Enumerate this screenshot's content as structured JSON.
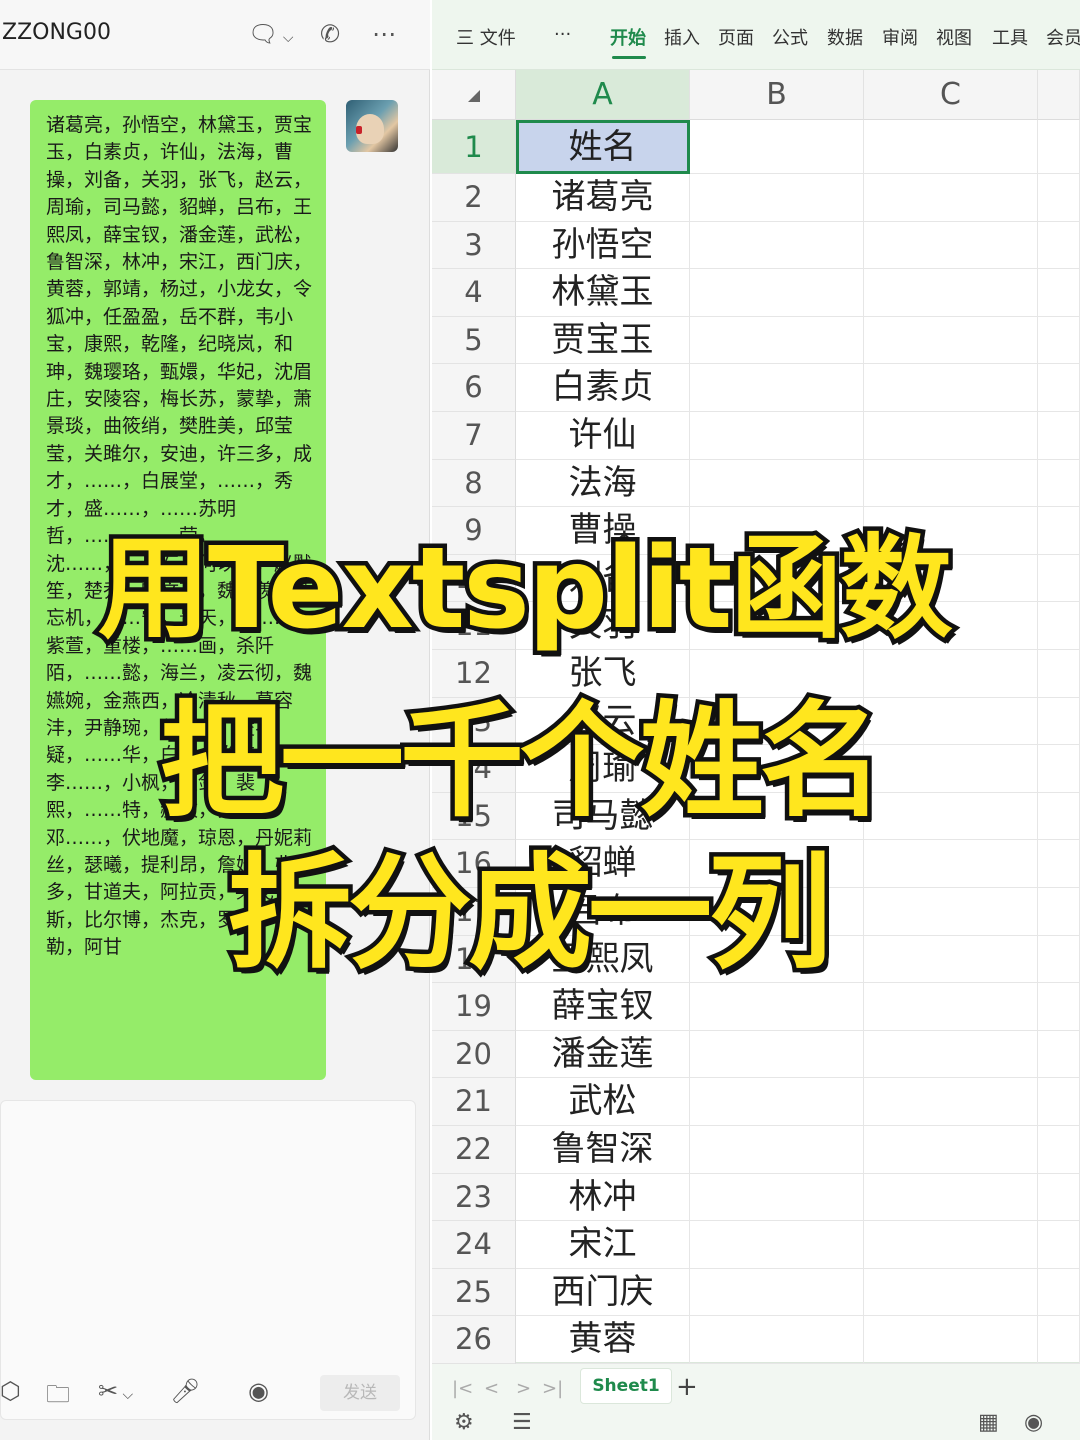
{
  "chat": {
    "title": "ZZONG00",
    "header_icons": [
      "chat-bubble-icon",
      "phone-icon",
      "more-icon"
    ],
    "message": "诸葛亮，孙悟空，林黛玉，贾宝玉，白素贞，许仙，法海，曹操，刘备，关羽，张飞，赵云，周瑜，司马懿，貂蝉，吕布，王熙凤，薛宝钗，潘金莲，武松，鲁智深，林冲，宋江，西门庆，黄蓉，郭靖，杨过，小龙女，令狐冲，任盈盈，岳不群，韦小宝，康熙，乾隆，纪晓岚，和珅，魏璎珞，甄嬛，华妃，沈眉庄，安陵容，梅长苏，蒙挚，萧景琰，曲筱绡，樊胜美，邱莹莹，关雎尔，安迪，许三多，成才，……，白展堂，……，秀才，盛……，……苏明哲，……，……莹，沈……，……石，何以琛，赵默笙，楚乔，宇文玥，魏无羡，蓝忘机，……宁，景天，唐……，紫萱，重楼，……画，杀阡陌，……懿，海兰，凌云彻，魏嬿婉，金燕西，冷清秋，慕容沣，尹静琬，程少商，凌不疑，……华，白浅，拳苍，李……，小枫，顾剑，裴熙，……特，赫敏，罗恩，邓……，伏地魔，琼恩，丹妮莉丝，瑟曦，提利昂，詹姆，弗罗多，甘道夫，阿拉贡，莱戈拉斯，比尔博，杰克，罗斯，辛德勒，阿甘",
    "send_label": "发送",
    "toolbar_icons": [
      "box-icon",
      "folder-icon",
      "scissors-icon",
      "mic-icon",
      "voice-icon"
    ]
  },
  "sheet": {
    "ribbon": {
      "menu_label": "三 文件",
      "more_label": "···",
      "tabs": [
        "开始",
        "插入",
        "页面",
        "公式",
        "数据",
        "审阅",
        "视图",
        "工具",
        "会员"
      ],
      "active_tab": "开始"
    },
    "columns": [
      "A",
      "B",
      "C"
    ],
    "rows": [
      {
        "num": "1",
        "value": "姓名"
      },
      {
        "num": "2",
        "value": "诸葛亮"
      },
      {
        "num": "3",
        "value": "孙悟空"
      },
      {
        "num": "4",
        "value": "林黛玉"
      },
      {
        "num": "5",
        "value": "贾宝玉"
      },
      {
        "num": "6",
        "value": "白素贞"
      },
      {
        "num": "7",
        "value": "许仙"
      },
      {
        "num": "8",
        "value": "法海"
      },
      {
        "num": "9",
        "value": "曹操"
      },
      {
        "num": "10",
        "value": "刘备"
      },
      {
        "num": "11",
        "value": "关羽"
      },
      {
        "num": "12",
        "value": "张飞"
      },
      {
        "num": "13",
        "value": "赵云"
      },
      {
        "num": "14",
        "value": "周瑜"
      },
      {
        "num": "15",
        "value": "司马懿"
      },
      {
        "num": "16",
        "value": "貂蝉"
      },
      {
        "num": "17",
        "value": "吕布"
      },
      {
        "num": "18",
        "value": "王熙凤"
      },
      {
        "num": "19",
        "value": "薛宝钗"
      },
      {
        "num": "20",
        "value": "潘金莲"
      },
      {
        "num": "21",
        "value": "武松"
      },
      {
        "num": "22",
        "value": "鲁智深"
      },
      {
        "num": "23",
        "value": "林冲"
      },
      {
        "num": "24",
        "value": "宋江"
      },
      {
        "num": "25",
        "value": "西门庆"
      },
      {
        "num": "26",
        "value": "黄蓉"
      }
    ],
    "sheet_tab": "Sheet1",
    "add_sheet": "+",
    "nav_arrows": [
      "|<",
      "<",
      ">",
      ">|"
    ]
  },
  "overlay": {
    "line1": "用Textsplit函数",
    "line2": "把一千个姓名",
    "line3": "拆分成一列"
  },
  "colors": {
    "bubble": "#95ec69",
    "accent": "#1f8a4c",
    "caption_fill": "#ffe61e",
    "caption_stroke": "#111111"
  }
}
